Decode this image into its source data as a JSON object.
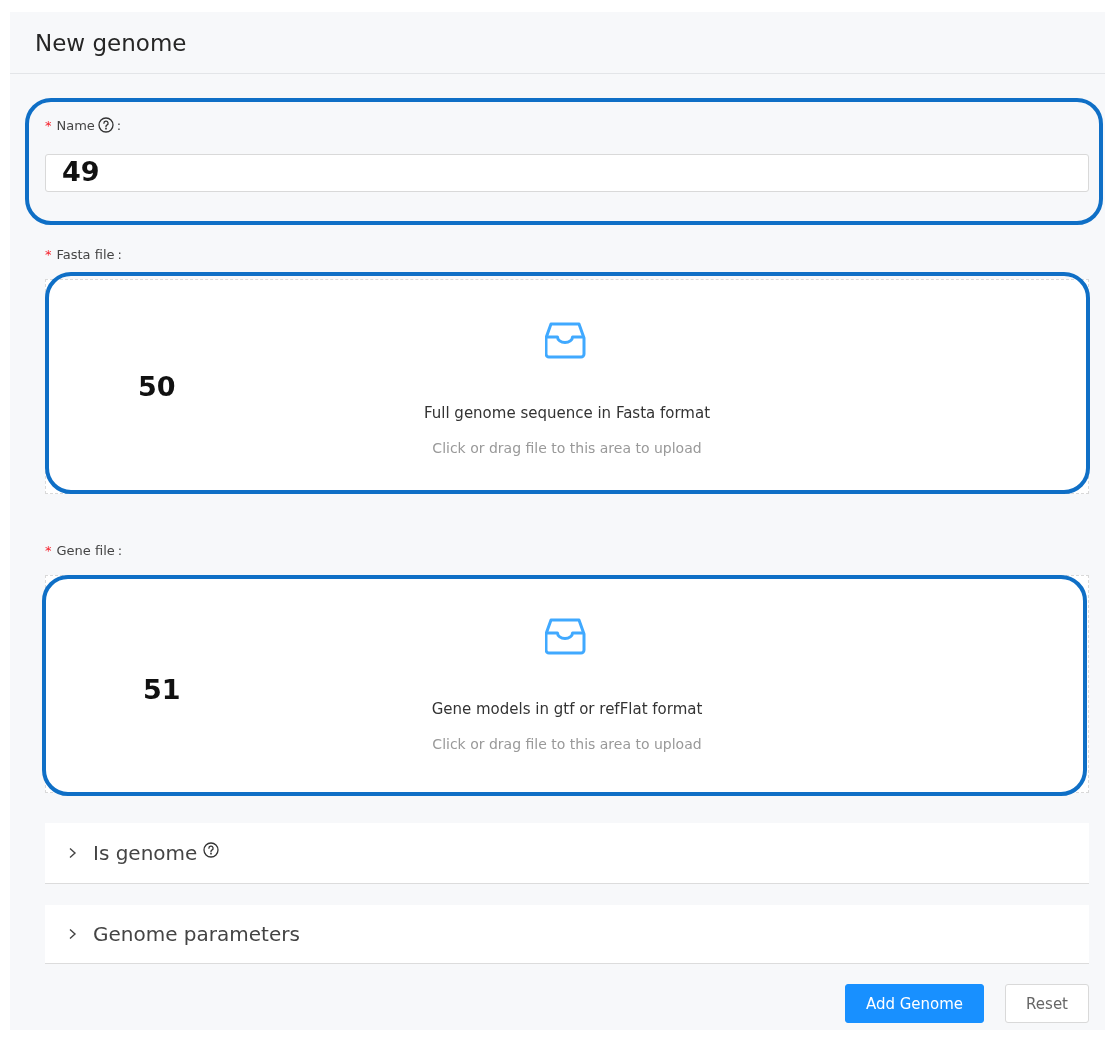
{
  "title": "New genome",
  "fields": [
    {
      "kind": "input",
      "mark": "*",
      "label": "Name",
      "help": true,
      "colon": ":",
      "callout": "49"
    },
    {
      "kind": "upload",
      "mark": "*",
      "label": "Fasta file",
      "help": false,
      "colon": ":",
      "text": "Full genome sequence in Fasta format",
      "hint": "Click or drag file to this area to upload",
      "callout": "50"
    },
    {
      "kind": "upload",
      "mark": "*",
      "label": "Gene file",
      "help": false,
      "colon": ":",
      "text": "Gene models in gtf or refFlat format",
      "hint": "Click or drag file to this area to upload",
      "callout": "51"
    }
  ],
  "panels": [
    {
      "label": "Is genome",
      "help": true,
      "expanded": false
    },
    {
      "label": "Genome parameters",
      "help": false,
      "expanded": false
    }
  ],
  "buttons": [
    {
      "label": "Add Genome",
      "kind": "primary"
    },
    {
      "label": "Reset",
      "kind": "default"
    }
  ]
}
